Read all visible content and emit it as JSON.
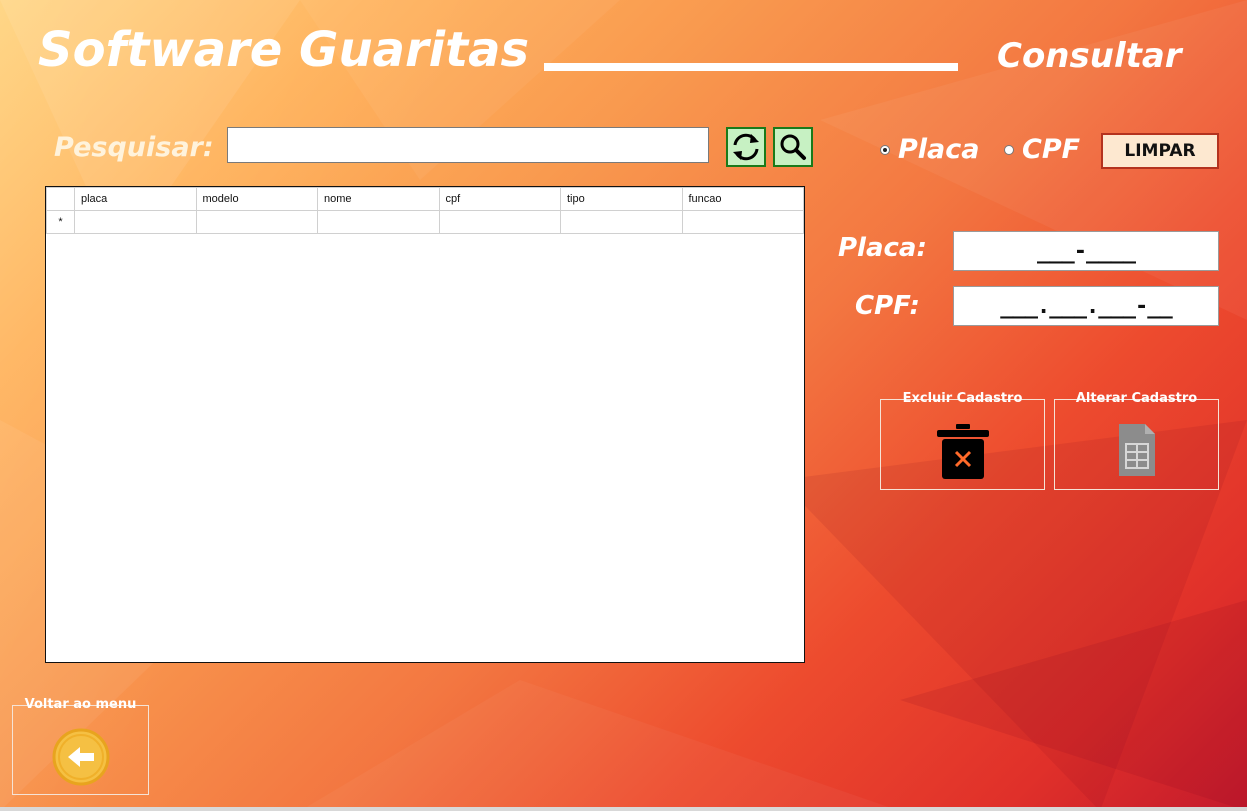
{
  "header": {
    "title": "Software Guaritas",
    "subtitle": "Consultar"
  },
  "search": {
    "label": "Pesquisar:",
    "value": "",
    "placeholder": ""
  },
  "filter": {
    "options": [
      "Placa",
      "CPF"
    ],
    "selected": "Placa",
    "clear_label": "LIMPAR"
  },
  "grid": {
    "columns": [
      "placa",
      "modelo",
      "nome",
      "cpf",
      "tipo",
      "funcao"
    ],
    "new_row_marker": "*"
  },
  "fields": {
    "placa_label": "Placa:",
    "placa_mask": "___-____",
    "cpf_label": "CPF:",
    "cpf_mask": "___.___.___-__"
  },
  "actions": {
    "delete_label": "Excluir Cadastro",
    "edit_label": "Alterar Cadastro",
    "back_label": "Voltar ao menu"
  },
  "colors": {
    "accent_green": "#1a7a1a",
    "button_green_bg": "#c7f1c3",
    "back_button": "#f5c043"
  },
  "icons": {
    "refresh": "refresh-icon",
    "search": "search-icon",
    "delete": "trash-icon",
    "edit": "spreadsheet-icon",
    "back": "arrow-left-icon"
  }
}
